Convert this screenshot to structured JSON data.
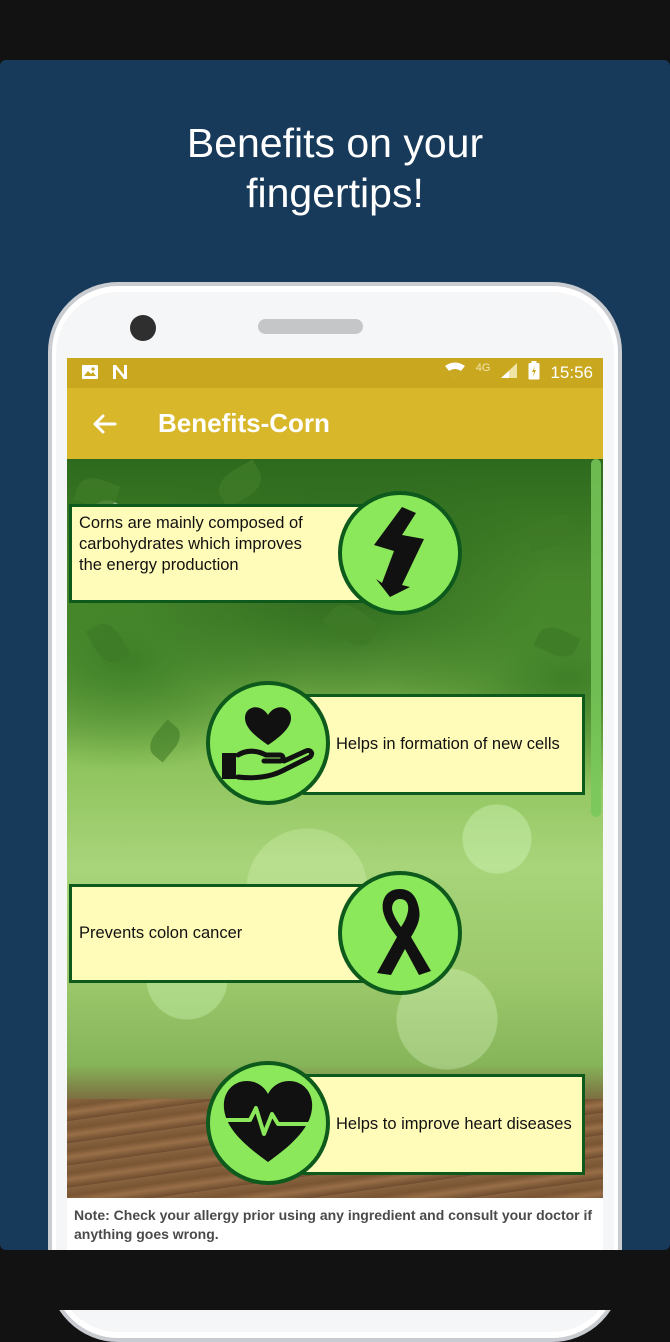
{
  "promo": {
    "headline_line1": "Benefits on your",
    "headline_line2": "fingertips!"
  },
  "status_bar": {
    "left_icons": [
      "image-icon",
      "n-notification-icon"
    ],
    "right_icons": [
      "wifi-icon",
      "signal-icon",
      "battery-icon"
    ],
    "network": "4G",
    "time": "15:56"
  },
  "app_bar": {
    "title": "Benefits-Corn",
    "back_icon": "arrow-left-icon"
  },
  "benefits": [
    {
      "text": "Corns are mainly composed of carbohydrates which improves the energy production",
      "icon": "lightning-bolt-icon"
    },
    {
      "text": "Helps in formation of new cells",
      "icon": "heart-in-hand-icon"
    },
    {
      "text": "Prevents colon cancer",
      "icon": "awareness-ribbon-icon"
    },
    {
      "text": "Helps to improve heart diseases",
      "icon": "heartbeat-icon"
    }
  ],
  "note": "Note: Check your allergy prior using any ingredient and consult your doctor if anything goes wrong.",
  "colors": {
    "promo_background": "#17395a",
    "status_bar": "#c9a81f",
    "app_bar": "#d8b72a",
    "card_fill": "#fffbb8",
    "card_border": "#0e5a1c",
    "badge_fill": "#8be85a"
  }
}
